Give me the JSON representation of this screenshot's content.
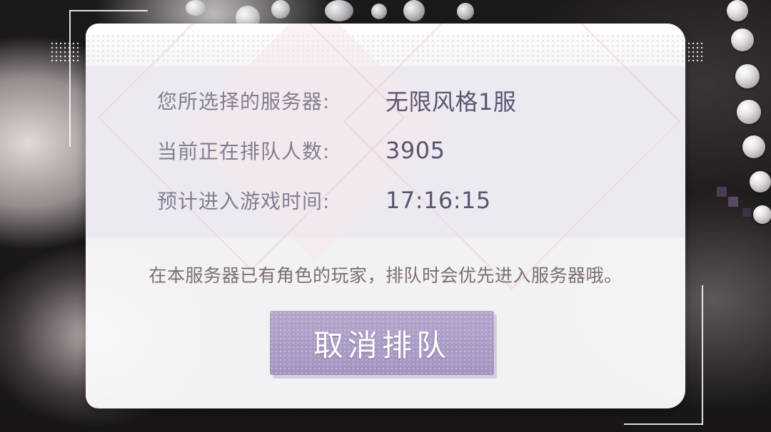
{
  "queue": {
    "server_label": "您所选择的服务器:",
    "server_value": "无限风格1服",
    "queue_count_label": "当前正在排队人数:",
    "queue_count_value": "3905",
    "eta_label": "预计进入游戏时间:",
    "eta_value": "17:16:15"
  },
  "notice": "在本服务器已有角色的玩家，排队时会优先进入服务器哦。",
  "cancel_button_label": "取消排队",
  "colors": {
    "label_text": "#827e92",
    "value_text": "#5a5470",
    "notice_text": "#7c6f6c",
    "button_fill": "#a99ac5"
  }
}
